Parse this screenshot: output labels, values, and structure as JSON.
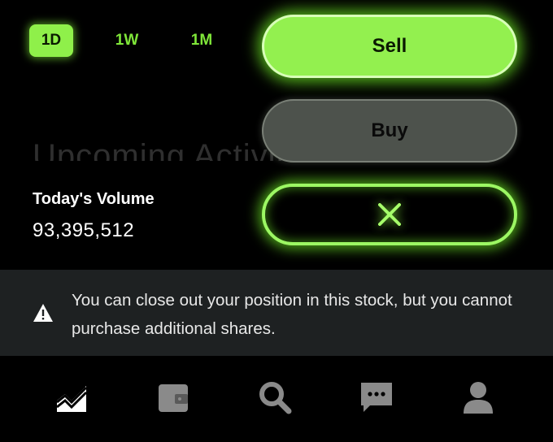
{
  "range_tabs": [
    {
      "label": "1D",
      "active": true
    },
    {
      "label": "1W",
      "active": false
    },
    {
      "label": "1M",
      "active": false
    }
  ],
  "background_heading": "Upcoming Activity",
  "stats": {
    "volume_label": "Today's Volume",
    "volume_value": "93,395,512"
  },
  "actions": {
    "sell_label": "Sell",
    "buy_label": "Buy",
    "close_icon": "close-x-icon"
  },
  "warning": {
    "icon": "warning-triangle-icon",
    "text": "You can close out your position in this stock, but you cannot purchase additional shares."
  },
  "bottom_nav": [
    {
      "icon": "chart-icon",
      "active": true
    },
    {
      "icon": "wallet-icon",
      "active": false
    },
    {
      "icon": "search-icon",
      "active": false
    },
    {
      "icon": "messages-icon",
      "active": false
    },
    {
      "icon": "account-icon",
      "active": false
    }
  ],
  "colors": {
    "accent": "#93f04f",
    "background": "#000000",
    "banner": "#1e2122",
    "icon_inactive": "#8a8a8a"
  }
}
